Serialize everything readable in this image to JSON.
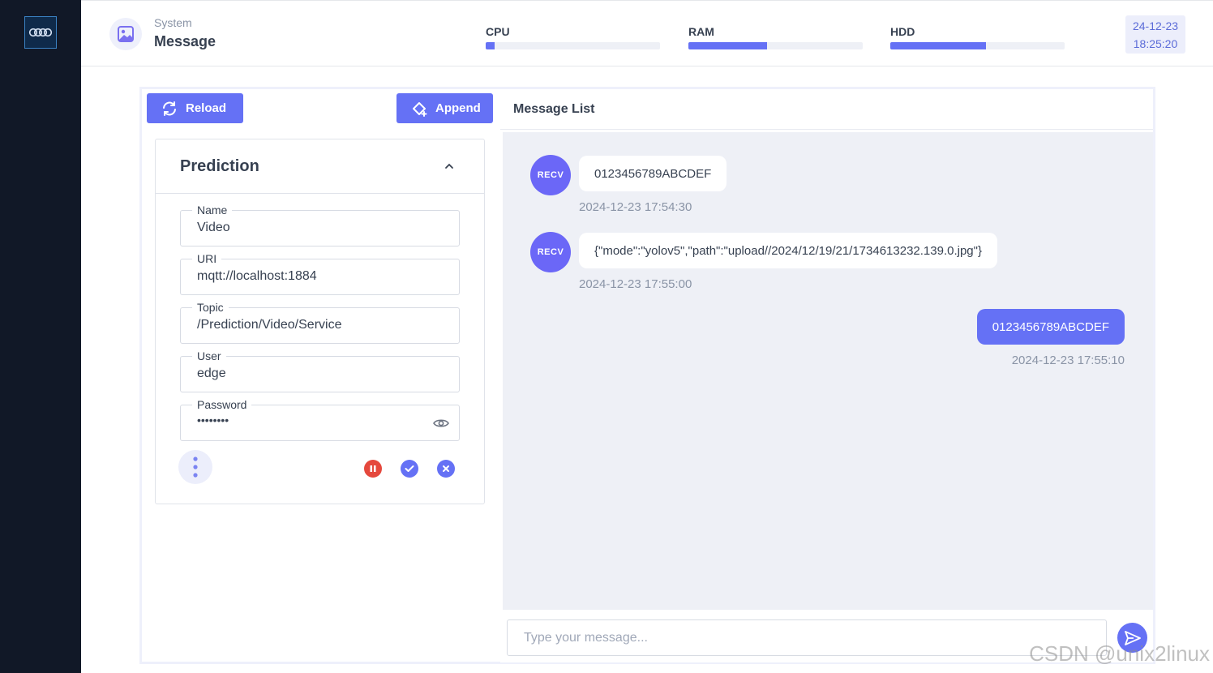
{
  "header": {
    "breadcrumb_parent": "System",
    "title": "Message",
    "meters": [
      {
        "label": "CPU",
        "percent": 5
      },
      {
        "label": "RAM",
        "percent": 45
      },
      {
        "label": "HDD",
        "percent": 55
      }
    ],
    "date": "24-12-23",
    "time": "18:25:20"
  },
  "toolbar": {
    "reload_label": "Reload",
    "append_label": "Append"
  },
  "card": {
    "title": "Prediction",
    "fields": [
      {
        "label": "Name",
        "value": "Video"
      },
      {
        "label": "URI",
        "value": "mqtt://localhost:1884"
      },
      {
        "label": "Topic",
        "value": "/Prediction/Video/Service"
      },
      {
        "label": "User",
        "value": "edge"
      },
      {
        "label": "Password",
        "value": "••••••••"
      }
    ]
  },
  "messages": {
    "title": "Message List",
    "items": [
      {
        "direction": "recv",
        "avatar": "RECV",
        "text": "0123456789ABCDEF",
        "time": "2024-12-23 17:54:30"
      },
      {
        "direction": "recv",
        "avatar": "RECV",
        "text": "{\"mode\":\"yolov5\",\"path\":\"upload//2024/12/19/21/1734613232.139.0.jpg\"}",
        "time": "2024-12-23 17:55:00"
      },
      {
        "direction": "sent",
        "text": "0123456789ABCDEF",
        "time": "2024-12-23 17:55:10"
      }
    ],
    "input_placeholder": "Type your message..."
  },
  "watermark": "CSDN @unix2linux",
  "colors": {
    "accent": "#6571f5",
    "sidebar": "#111827",
    "danger": "#e5483d",
    "chat_bg": "#eef0f6"
  },
  "icons": [
    "logo-icon",
    "image-icon",
    "reload-icon",
    "append-icon",
    "chevron-up-icon",
    "eye-icon",
    "more-vert-icon",
    "pause-icon",
    "check-icon",
    "close-icon",
    "send-icon"
  ]
}
